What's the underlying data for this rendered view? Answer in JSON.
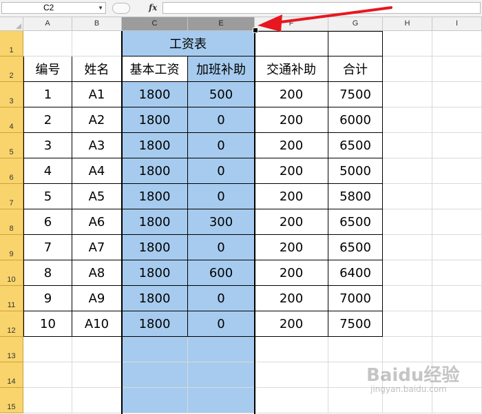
{
  "formula_bar": {
    "name_box": "C2",
    "fx_label": "fx",
    "formula": ""
  },
  "columns": [
    "A",
    "B",
    "C",
    "E",
    "F",
    "G",
    "H",
    "I"
  ],
  "rows": [
    "1",
    "2",
    "3",
    "4",
    "5",
    "6",
    "7",
    "8",
    "9",
    "10",
    "11",
    "12",
    "13",
    "14",
    "15"
  ],
  "sheet": {
    "title": "工资表",
    "headers": [
      "编号",
      "姓名",
      "基本工资",
      "加班补助",
      "交通补助",
      "合计"
    ],
    "data": [
      [
        "1",
        "A1",
        "1800",
        "500",
        "200",
        "7500"
      ],
      [
        "2",
        "A2",
        "1800",
        "0",
        "200",
        "6000"
      ],
      [
        "3",
        "A3",
        "1800",
        "0",
        "200",
        "6500"
      ],
      [
        "4",
        "A4",
        "1800",
        "0",
        "200",
        "5000"
      ],
      [
        "5",
        "A5",
        "1800",
        "0",
        "200",
        "5800"
      ],
      [
        "6",
        "A6",
        "1800",
        "300",
        "200",
        "6500"
      ],
      [
        "7",
        "A7",
        "1800",
        "0",
        "200",
        "6500"
      ],
      [
        "8",
        "A8",
        "1800",
        "600",
        "200",
        "6400"
      ],
      [
        "9",
        "A9",
        "1800",
        "0",
        "200",
        "7000"
      ],
      [
        "10",
        "A10",
        "1800",
        "0",
        "200",
        "7500"
      ]
    ]
  },
  "selection": {
    "columns": [
      "C",
      "E"
    ],
    "color": "#a6cbee",
    "header_color": "#9c9c9c"
  },
  "annotation": {
    "icon": "red-arrow-icon",
    "color": "#e8161f",
    "points_to": "column-header-gap-E-F"
  },
  "watermark": {
    "logo": "Baidu经验",
    "url": "jingyan.baidu.com"
  }
}
